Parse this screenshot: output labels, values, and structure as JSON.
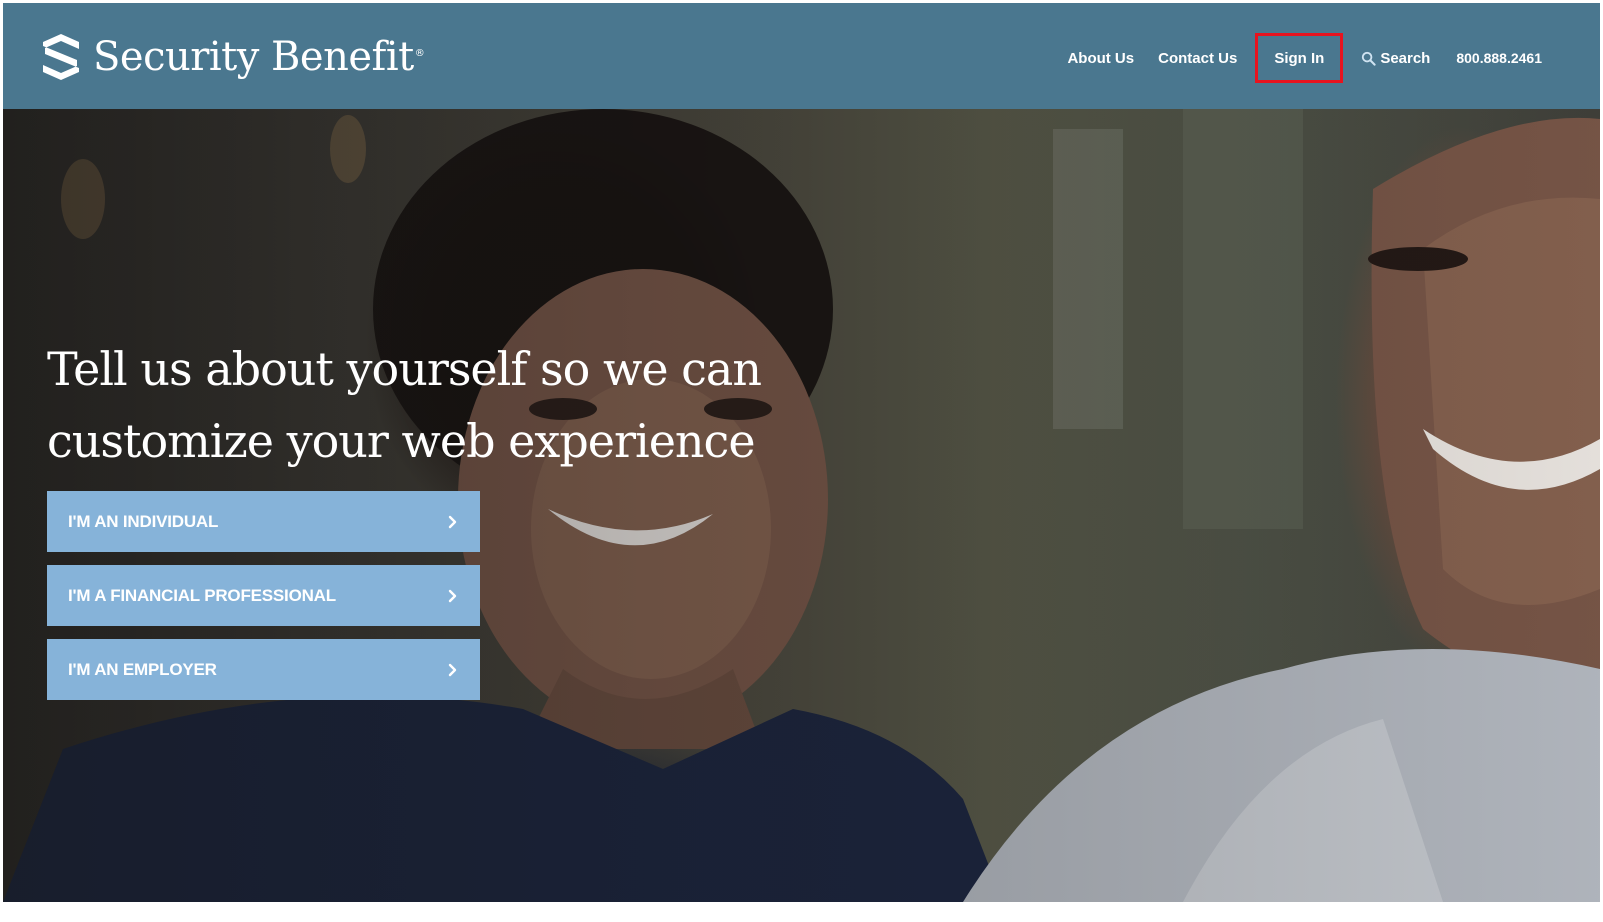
{
  "header": {
    "brand": "Security Benefit",
    "brand_reg": "®",
    "nav": {
      "about": "About Us",
      "contact": "Contact Us",
      "signin": "Sign In",
      "search": "Search",
      "phone": "800.888.2461"
    },
    "icons": {
      "logo": "security-benefit-logo-icon",
      "search": "search-icon"
    }
  },
  "hero": {
    "title": "Tell us about yourself so we can customize your web experience",
    "ctas": [
      {
        "label": "I'M AN INDIVIDUAL"
      },
      {
        "label": "I'M A FINANCIAL PROFESSIONAL"
      },
      {
        "label": "I'M AN EMPLOYER"
      }
    ],
    "cta_icon": "chevron-right-icon"
  },
  "colors": {
    "header_bg": "#4a778f",
    "cta_bg": "#86b3d9",
    "highlight": "#e8131e",
    "text": "#ffffff"
  }
}
